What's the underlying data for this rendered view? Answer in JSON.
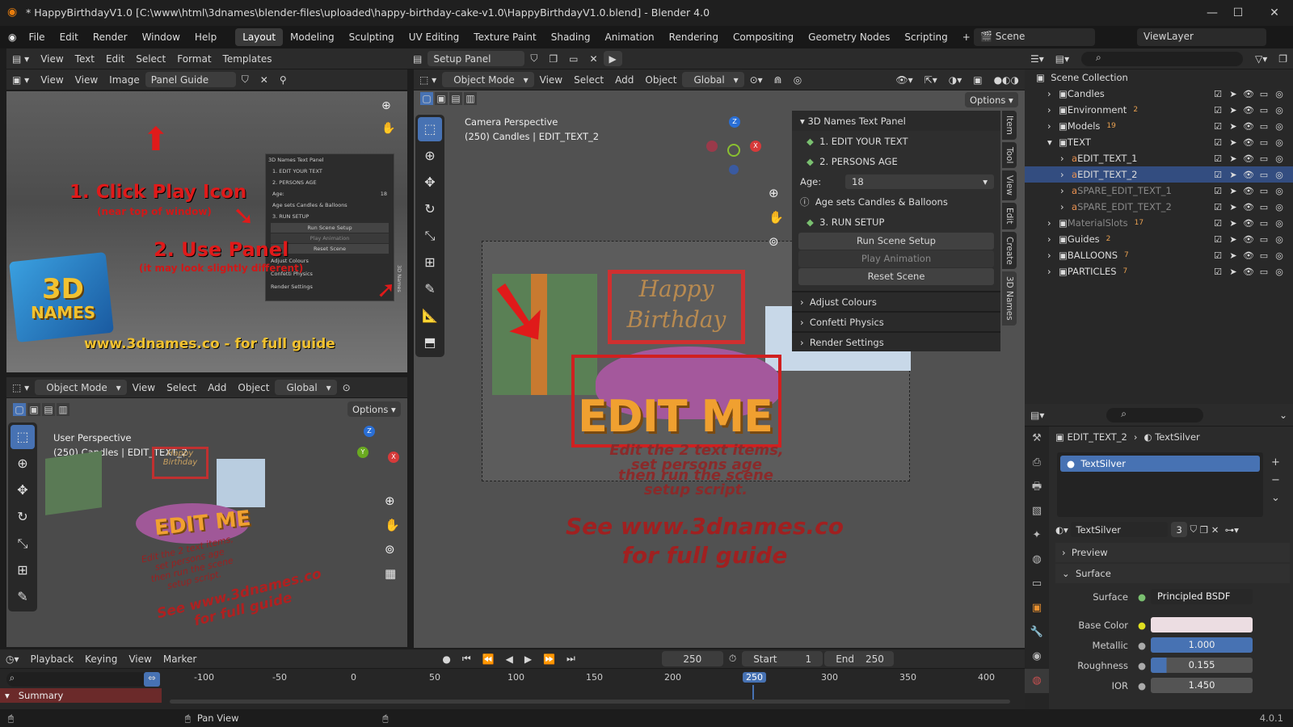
{
  "window": {
    "title": "* HappyBirthdayV1.0 [C:\\www\\html\\3dnames\\blender-files\\uploaded\\happy-birthday-cake-v1.0\\HappyBirthdayV1.0.blend] - Blender 4.0"
  },
  "menu": {
    "items": [
      "File",
      "Edit",
      "Render",
      "Window",
      "Help"
    ],
    "workspaces": [
      "Layout",
      "Modeling",
      "Sculpting",
      "UV Editing",
      "Texture Paint",
      "Shading",
      "Animation",
      "Rendering",
      "Compositing",
      "Geometry Nodes",
      "Scripting"
    ],
    "scene": "Scene",
    "view_layer": "ViewLayer"
  },
  "text_editor": {
    "menus": [
      "View",
      "Text",
      "Edit",
      "Select",
      "Format",
      "Templates"
    ],
    "file": "Setup Panel"
  },
  "image_editor": {
    "menus": [
      "View",
      "View",
      "Image"
    ],
    "image_name": "Panel Guide",
    "guide_panel": {
      "title": "3D Names Text Panel",
      "items": [
        "1. EDIT YOUR TEXT",
        "2. PERSONS AGE",
        "Age:",
        "18",
        "Age sets Candles & Balloons",
        "3. RUN SETUP",
        "Run Scene Setup",
        "Play Animation",
        "Reset Scene",
        "Adjust Colours",
        "Confetti Physics",
        "Render Settings"
      ],
      "side_tab": "3D Names"
    },
    "guide": {
      "step1": "1. Click Play Icon",
      "step1_sub": "(near top of window)",
      "step2": "2. Use Panel",
      "step2_sub": "(it may look slightly different)",
      "logo_line1": "3D",
      "logo_line2": "NAMES",
      "url": "www.3dnames.co - for full guide"
    }
  },
  "viewport_main": {
    "mode": "Object Mode",
    "menus": [
      "View",
      "Select",
      "Add",
      "Object"
    ],
    "orientation": "Global",
    "options": "Options",
    "perspective": "Camera Perspective",
    "context": "(250) Candles | EDIT_TEXT_2",
    "gizmo_z": "Z",
    "gizmo_x": "X",
    "scene_text": {
      "topper1": "Happy",
      "topper2": "Birthday",
      "edit": "EDIT ME",
      "instr1": "Edit the 2 text items,",
      "instr2": "set persons age",
      "instr3": "then run the scene",
      "instr4": "setup script.",
      "see1": "See www.3dnames.co",
      "see2": "for full guide"
    }
  },
  "n_panel": {
    "title": "3D Names Text Panel",
    "step1": "1. EDIT YOUR TEXT",
    "step2": "2. PERSONS AGE",
    "age_label": "Age:",
    "age_value": "18",
    "age_note": "Age sets Candles & Balloons",
    "step3": "3. RUN SETUP",
    "run_btn": "Run Scene Setup",
    "play_btn": "Play Animation",
    "reset_btn": "Reset Scene",
    "sections": [
      "Adjust Colours",
      "Confetti Physics",
      "Render Settings"
    ],
    "tabs": [
      "Item",
      "Tool",
      "View",
      "Edit",
      "Create",
      "3D Names"
    ]
  },
  "viewport_bottom": {
    "mode": "Object Mode",
    "menus": [
      "View",
      "Select",
      "Add",
      "Object"
    ],
    "orientation": "Global",
    "options": "Options",
    "perspective": "User Perspective",
    "context": "(250) Candles | EDIT_TEXT_2",
    "gizmo": [
      "Z",
      "Y",
      "X"
    ],
    "scene_text": {
      "topper1": "Happy",
      "topper2": "Birthday",
      "edit": "EDIT ME",
      "instr1": "Edit the 2 text items,",
      "instr2": "set persons age",
      "instr3": "then run the scene",
      "instr4": "setup script.",
      "see1": "See www.3dnames.co",
      "see2": "for full guide"
    }
  },
  "outliner": {
    "root": "Scene Collection",
    "rows": [
      {
        "label": "Candles",
        "badge": ""
      },
      {
        "label": "Environment",
        "badge": "2"
      },
      {
        "label": "Models",
        "badge": "19"
      },
      {
        "label": "TEXT",
        "badge": ""
      },
      {
        "label": "EDIT_TEXT_1",
        "badge": ""
      },
      {
        "label": "EDIT_TEXT_2",
        "badge": ""
      },
      {
        "label": "SPARE_EDIT_TEXT_1",
        "badge": ""
      },
      {
        "label": "SPARE_EDIT_TEXT_2",
        "badge": ""
      },
      {
        "label": "MaterialSlots",
        "badge": "17"
      },
      {
        "label": "Guides",
        "badge": "2"
      },
      {
        "label": "BALLOONS",
        "badge": "7"
      },
      {
        "label": "PARTICLES",
        "badge": "7"
      }
    ]
  },
  "properties": {
    "breadcrumb_object": "EDIT_TEXT_2",
    "breadcrumb_material": "TextSilver",
    "slot": "TextSilver",
    "material_name": "TextSilver",
    "users": "3",
    "preview": "Preview",
    "surface_section": "Surface",
    "surface_label": "Surface",
    "surface_value": "Principled BSDF",
    "base_color_label": "Base Color",
    "base_color": "#ecdde2",
    "metallic_label": "Metallic",
    "metallic": "1.000",
    "roughness_label": "Roughness",
    "roughness": "0.155",
    "ior_label": "IOR",
    "ior": "1.450"
  },
  "timeline": {
    "menus": [
      "Playback",
      "Keying",
      "View",
      "Marker"
    ],
    "current_frame": "250",
    "start_label": "Start",
    "start": "1",
    "end_label": "End",
    "end": "250",
    "ticks": [
      "-100",
      "-50",
      "0",
      "50",
      "100",
      "150",
      "200",
      "250",
      "300",
      "350",
      "400"
    ],
    "summary": "Summary"
  },
  "status": {
    "action": "Pan View",
    "version": "4.0.1"
  },
  "colors": {
    "accent": "#4772b3",
    "selection": "#334d80",
    "red": "#e02020",
    "gold": "#f0a030"
  }
}
